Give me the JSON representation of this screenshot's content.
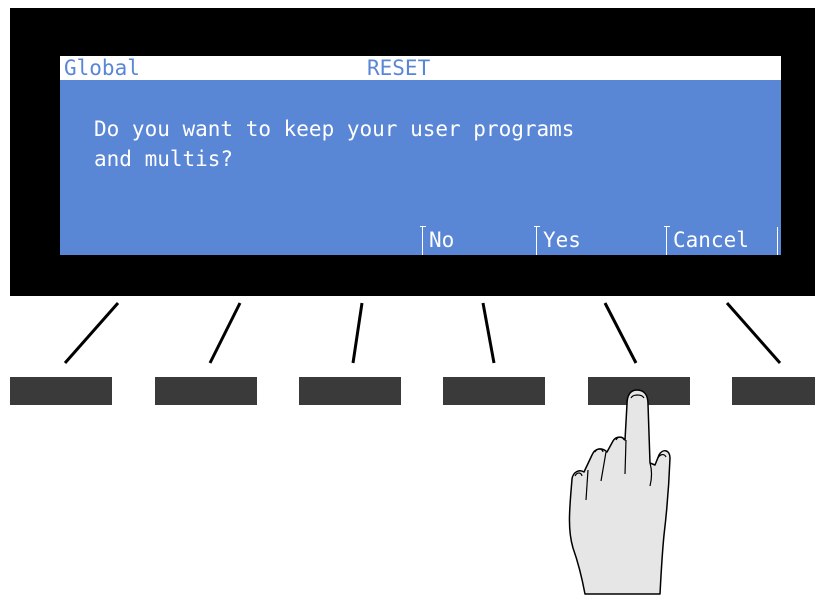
{
  "display": {
    "mode": "Global",
    "page_title": "RESET",
    "message": "Do you want to keep your user programs\nand multis?",
    "softkeys": {
      "no": "No",
      "yes": "Yes",
      "cancel": "Cancel"
    }
  },
  "colors": {
    "lcd_blue": "#5a86d6",
    "bezel": "#000000",
    "button": "#3a3a3a"
  },
  "icons": {
    "pointer": "hand-pointer-icon"
  }
}
